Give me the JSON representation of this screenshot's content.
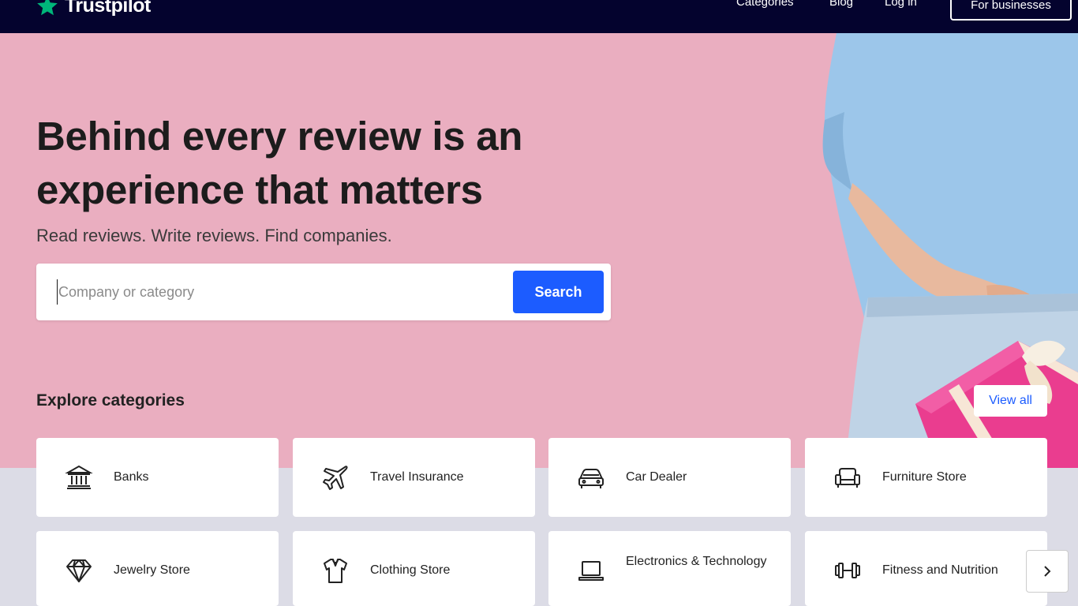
{
  "header": {
    "logo_text": "Trustpilot",
    "nav": [
      "Categories",
      "Blog",
      "Log in"
    ],
    "business_button": "For businesses"
  },
  "hero": {
    "headline": "Behind every review is an experience that matters",
    "subline": "Read reviews. Write reviews. Find companies.",
    "search": {
      "placeholder": "Company or category",
      "value": "",
      "button": "Search"
    }
  },
  "categories": {
    "title": "Explore categories",
    "view_all": "View all",
    "items": [
      {
        "label": "Banks",
        "icon": "bank-icon"
      },
      {
        "label": "Travel Insurance",
        "icon": "airplane-icon"
      },
      {
        "label": "Car Dealer",
        "icon": "car-icon"
      },
      {
        "label": "Furniture Store",
        "icon": "armchair-icon"
      },
      {
        "label": "Jewelry Store",
        "icon": "diamond-icon"
      },
      {
        "label": "Clothing Store",
        "icon": "shirt-icon"
      },
      {
        "label": "Electronics & Technology",
        "icon": "laptop-icon"
      },
      {
        "label": "Fitness and Nutrition",
        "icon": "dumbbell-icon"
      }
    ]
  },
  "colors": {
    "header_bg": "#04032e",
    "hero_bg": "#eaaec0",
    "accent": "#1c5cff",
    "brand_star": "#00b67a"
  }
}
